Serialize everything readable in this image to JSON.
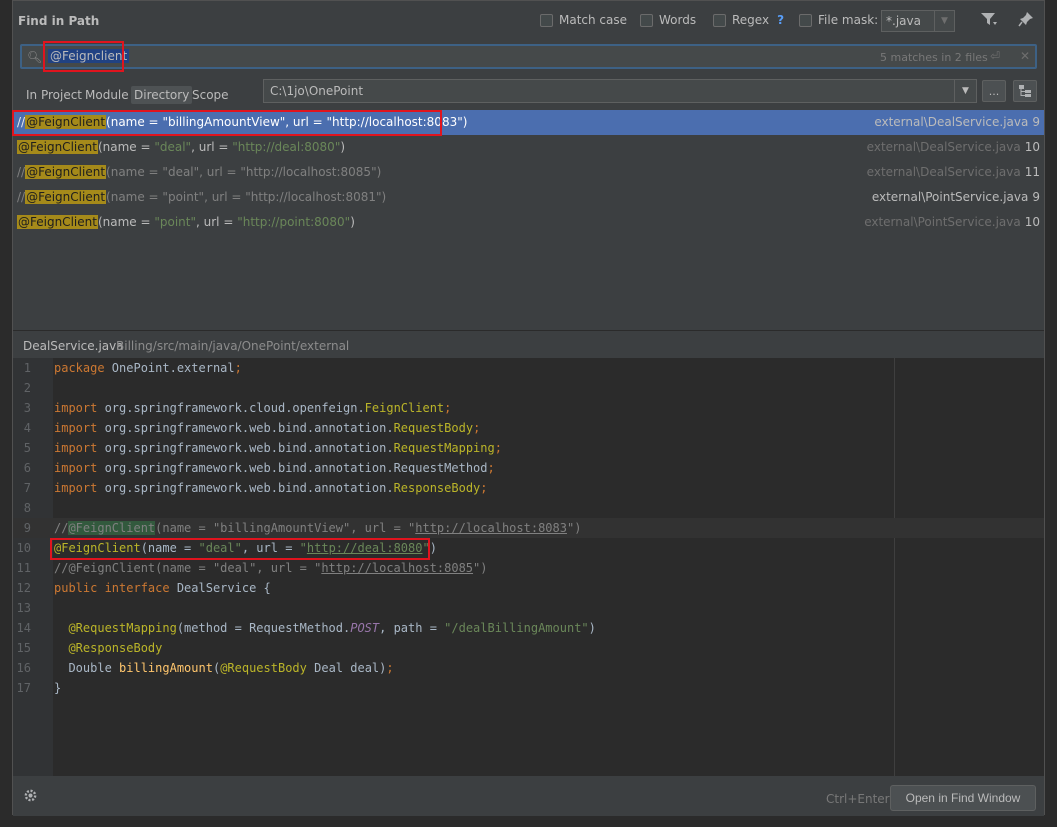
{
  "dialog": {
    "title": "Find in Path",
    "options": [
      {
        "label": "Match case",
        "checked": false
      },
      {
        "label": "Words",
        "checked": false
      },
      {
        "label": "Regex",
        "checked": false,
        "help": "?"
      },
      {
        "label": "File mask:",
        "checked": false
      }
    ],
    "file_mask": "*.java"
  },
  "search": {
    "query": "@Feignclient",
    "match_count": "5 matches in 2 files"
  },
  "scope": {
    "tabs": [
      "In Project",
      "Module",
      "Directory",
      "Scope"
    ],
    "selected": "Directory",
    "directory": "C:\\1jo\\OnePoint",
    "browse_label": "..."
  },
  "results": [
    {
      "prefix": "//",
      "match": "@FeignClient",
      "args": [
        {
          "t": "(name = "
        },
        {
          "t": "\"billingAmountView\"",
          "s": true
        },
        {
          "t": ", url = "
        },
        {
          "t": "\"http://localhost:8083\"",
          "s": true
        },
        {
          "t": ")"
        }
      ],
      "file": "external\\DealService.java",
      "line": "9",
      "selected": true,
      "dim": false
    },
    {
      "prefix": "",
      "match": "@FeignClient",
      "args": [
        {
          "t": "(name = "
        },
        {
          "t": "\"deal\"",
          "s": true
        },
        {
          "t": ", url = "
        },
        {
          "t": "\"http://deal:8080\"",
          "s": true
        },
        {
          "t": ")"
        }
      ],
      "file": "external\\DealService.java",
      "line": "10",
      "selected": false,
      "dim": true
    },
    {
      "prefix": "//",
      "match": "@FeignClient",
      "args": [
        {
          "t": "(name = \"deal\", url = \"http://localhost:8085\")",
          "c": true
        }
      ],
      "file": "external\\DealService.java",
      "line": "11",
      "selected": false,
      "dim": true
    },
    {
      "prefix": "//",
      "match": "@FeignClient",
      "args": [
        {
          "t": "(name = \"point\", url = \"http://localhost:8081\")",
          "c": true
        }
      ],
      "file": "external\\PointService.java",
      "line": "9",
      "selected": false,
      "dim": false
    },
    {
      "prefix": "",
      "match": "@FeignClient",
      "args": [
        {
          "t": "(name = "
        },
        {
          "t": "\"point\"",
          "s": true
        },
        {
          "t": ", url = "
        },
        {
          "t": "\"http://point:8080\"",
          "s": true
        },
        {
          "t": ")"
        }
      ],
      "file": "external\\PointService.java",
      "line": "10",
      "selected": false,
      "dim": true
    }
  ],
  "preview": {
    "file_name": "DealService.java",
    "file_path": "Billing/src/main/java/OnePoint/external",
    "lines": [
      "1",
      "2",
      "3",
      "4",
      "5",
      "6",
      "7",
      "8",
      "9",
      "10",
      "11",
      "12",
      "13",
      "14",
      "15",
      "16",
      "17"
    ]
  },
  "footer": {
    "shortcut_hint": "Ctrl+Enter",
    "open_button": "Open in Find Window"
  },
  "colors": {
    "selection": "#4b6eaf",
    "match_highlight": "#a58a1a",
    "red_annotation": "#e0141e"
  }
}
